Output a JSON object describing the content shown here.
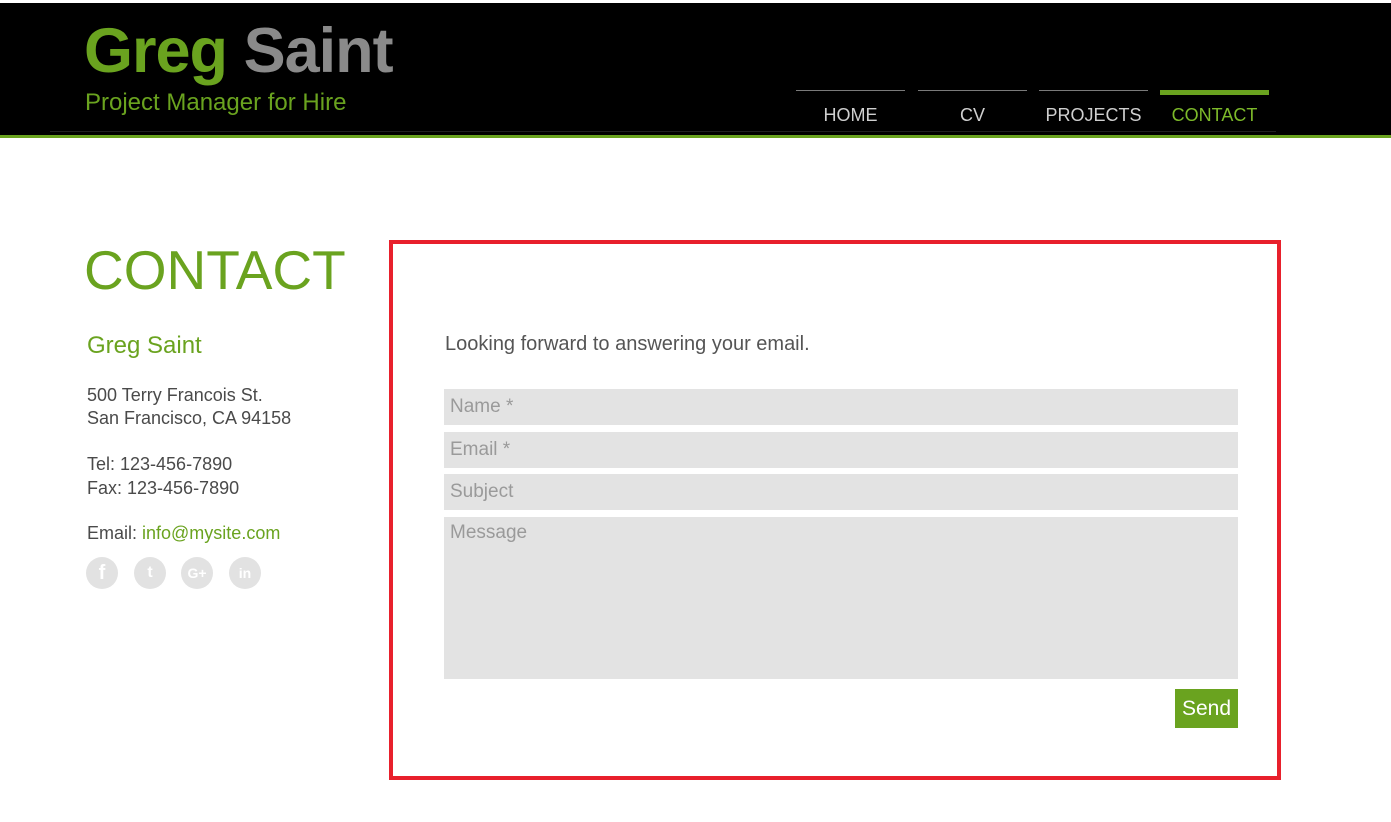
{
  "header": {
    "site_name_first": "Greg",
    "site_name_last": "Saint",
    "tagline": "Project Manager for Hire"
  },
  "nav": {
    "items": [
      {
        "label": "HOME"
      },
      {
        "label": "CV"
      },
      {
        "label": "PROJECTS"
      },
      {
        "label": "CONTACT",
        "active": true
      }
    ]
  },
  "contact": {
    "heading": "CONTACT",
    "name": "Greg Saint",
    "address_line1": "500 Terry Francois St.",
    "address_line2": "San Francisco, CA 94158",
    "tel": "Tel: 123-456-7890",
    "fax": "Fax: 123-456-7890",
    "email_label": "Email: ",
    "email": "info@mysite.com",
    "social": [
      {
        "icon": "facebook-icon",
        "glyph": "f"
      },
      {
        "icon": "twitter-icon",
        "glyph": "t"
      },
      {
        "icon": "google-plus-icon",
        "glyph": "G+"
      },
      {
        "icon": "linkedin-icon",
        "glyph": "in"
      }
    ]
  },
  "form": {
    "intro": "Looking forward to answering your email.",
    "name_placeholder": "Name *",
    "email_placeholder": "Email *",
    "subject_placeholder": "Subject",
    "message_placeholder": "Message",
    "send_label": "Send"
  },
  "colors": {
    "accent": "#6aa31f",
    "highlight_border": "#e8202c",
    "field_bg": "#e3e3e3"
  }
}
